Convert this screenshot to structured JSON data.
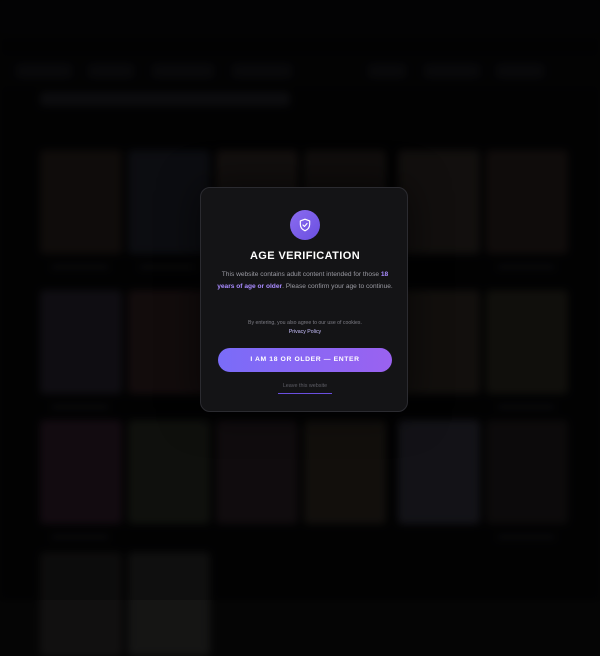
{
  "modal": {
    "icon": "shield-check-icon",
    "title": "AGE VERIFICATION",
    "description_before": "This website contains adult content intended for those",
    "description_highlight": "18 years of age or older",
    "description_after": ". Please confirm your age to continue.",
    "cookie_note": "By entering, you also agree to our use of cookies.",
    "privacy_link": "Privacy Policy",
    "enter_button": "I AM 18 OR OLDER — ENTER",
    "leave_link": "Leave this website"
  },
  "colors": {
    "accent": "#7a6cf8",
    "accent_alt": "#9a62f0",
    "highlight": "#a98bff",
    "modal_bg": "#141416",
    "page_bg": "#050505"
  }
}
